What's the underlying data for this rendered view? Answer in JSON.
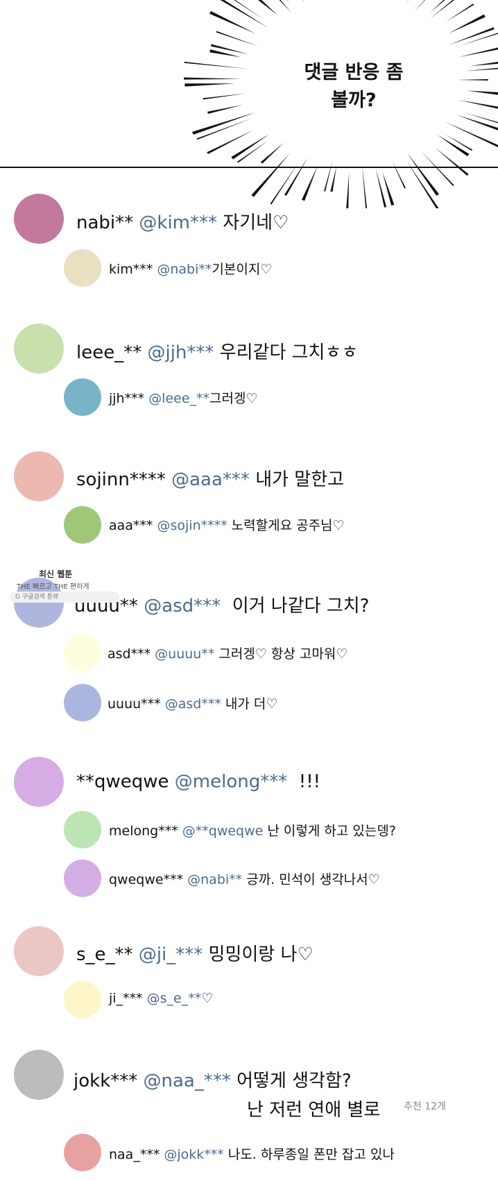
{
  "colors": {
    "mention": "#4c6a8f",
    "divider": "#111111"
  },
  "speech_bubble": {
    "line1": "댓글 반응 좀",
    "line2": "볼까?"
  },
  "watermark": {
    "title": "최신 웹툰",
    "subtitle": "THE 빠르고 THE 편하게",
    "badge": "G 구글검색  툰뷰"
  },
  "threads": [
    {
      "main": {
        "avatar_color": "#c3799c",
        "user": "nabi**",
        "mention": "@kim***",
        "text": "자기네♡"
      },
      "replies": [
        {
          "avatar_color": "#e8e0c0",
          "user": "kim***",
          "mention": "@nabi**",
          "text": "기본이지♡"
        }
      ]
    },
    {
      "main": {
        "avatar_color": "#c9e0ad",
        "user": "leee_**",
        "mention": "@jjh***",
        "text": "우리같다 그치ㅎㅎ"
      },
      "replies": [
        {
          "avatar_color": "#78b4c8",
          "user": "jjh***",
          "mention": "@leee_**",
          "text": "그러겡♡"
        }
      ]
    },
    {
      "main": {
        "avatar_color": "#ebb9b0",
        "user": "sojinn****",
        "mention": "@aaa***",
        "text": "내가 말한고"
      },
      "replies": [
        {
          "avatar_color": "#9ec878",
          "user": "aaa***",
          "mention": "@sojin****",
          "text": "노력할게요 공주님♡"
        }
      ]
    },
    {
      "main": {
        "avatar_color": "#aeb6dd",
        "user": "uuuu**",
        "mention": "@asd***",
        "text": "이거 나같다 그치?"
      },
      "replies": [
        {
          "avatar_color": "#fefde0",
          "user": "asd***",
          "mention": "@uuuu**",
          "text": "그러겡♡ 항상 고마워♡"
        },
        {
          "avatar_color": "#aab6dd",
          "user": "uuuu***",
          "mention": "@asd***",
          "text": "내가 더♡"
        }
      ]
    },
    {
      "main": {
        "avatar_color": "#d6ace4",
        "user": "**qweqwe",
        "mention": "@melong***",
        "text": "!!!"
      },
      "replies": [
        {
          "avatar_color": "#bde4b3",
          "user": "melong***",
          "mention": "@**qweqwe",
          "text": "난 이렇게 하고 있는뎅?"
        },
        {
          "avatar_color": "#d3aee4",
          "user": "qweqwe***",
          "mention": "@nabi**",
          "text": "긍까. 민석이 생각나서♡"
        }
      ]
    },
    {
      "main": {
        "avatar_color": "#ebc6c5",
        "user": "s_e_**",
        "mention": "@ji_***",
        "text": "밍밍이랑 나♡"
      },
      "replies": [
        {
          "avatar_color": "#fef5c8",
          "user": "ji_***",
          "mention": "@s_e_**",
          "text": "♡"
        }
      ]
    },
    {
      "main": {
        "avatar_color": "#bcbcbc",
        "user": "jokk***",
        "mention": "@naa_***",
        "text": "어떻게 생각함?",
        "text_line2": "난 저런 연애 별로"
      },
      "replies": [
        {
          "avatar_color": "#e9a2a2",
          "user": "naa_***",
          "mention": "@jokk***",
          "text": "나도. 하루종일 폰만 잡고 있나"
        }
      ]
    }
  ],
  "recommend": "추천 12개"
}
